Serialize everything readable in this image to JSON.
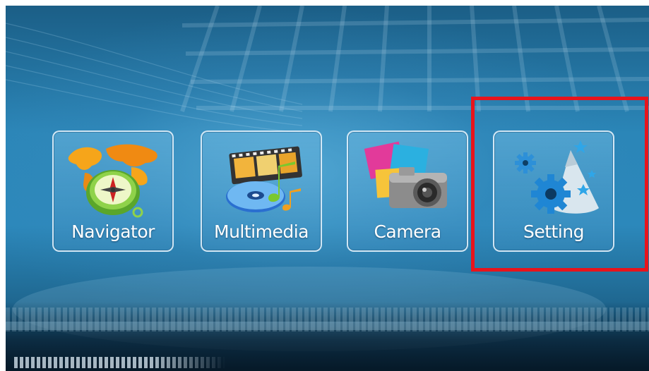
{
  "menu": {
    "items": [
      {
        "label": "Navigator",
        "icon": "globe-compass-icon"
      },
      {
        "label": "Multimedia",
        "icon": "film-disc-music-icon"
      },
      {
        "label": "Camera",
        "icon": "camera-photos-icon"
      },
      {
        "label": "Setting",
        "icon": "gears-party-hat-icon"
      }
    ],
    "highlighted": "Setting"
  },
  "colors": {
    "background": "#2b86b8",
    "tile_border": "#e1f0fa",
    "highlight": "#e8141c",
    "label": "#ffffff"
  }
}
